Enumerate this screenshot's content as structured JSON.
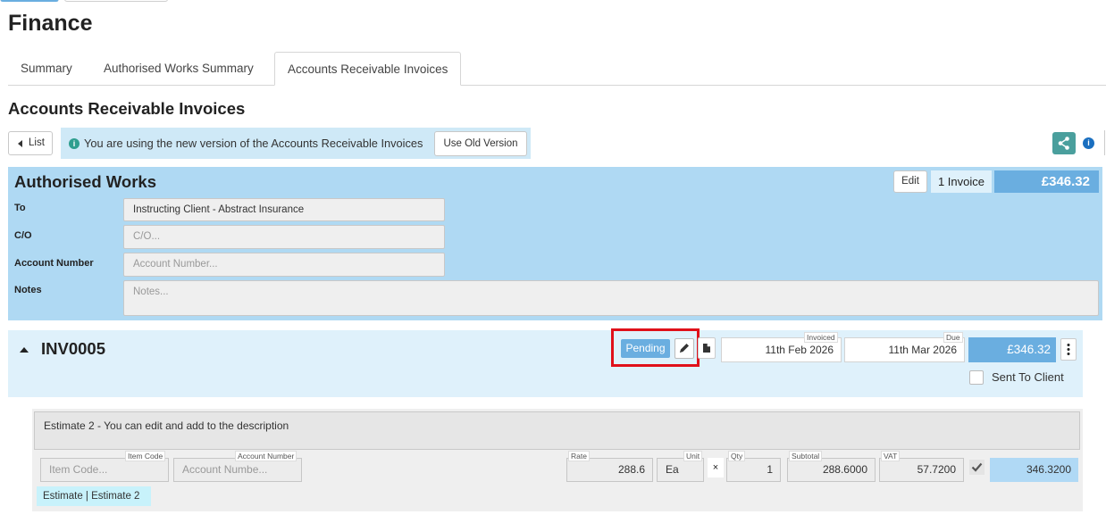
{
  "page": {
    "title": "Finance"
  },
  "tabs": [
    {
      "label": "Summary"
    },
    {
      "label": "Authorised Works Summary"
    },
    {
      "label": "Accounts Receivable Invoices"
    }
  ],
  "section": {
    "title": "Accounts Receivable Invoices",
    "list_button": "List",
    "notice": "You are using the new version of the Accounts Receivable Invoices",
    "old_version_button": "Use Old Version"
  },
  "authorised_works": {
    "title": "Authorised Works",
    "edit_button": "Edit",
    "invoice_count": "1 Invoice",
    "total": "£346.32",
    "to_label": "To",
    "to_value": "Instructing Client - Abstract Insurance",
    "co_label": "C/O",
    "co_placeholder": "C/O...",
    "account_label": "Account Number",
    "account_placeholder": "Account Number...",
    "notes_label": "Notes",
    "notes_placeholder": "Notes..."
  },
  "invoice": {
    "number": "INV0005",
    "status": "Pending",
    "invoiced_label": "Invoiced",
    "invoiced_date": "11th Feb 2026",
    "due_label": "Due",
    "due_date": "11th Mar 2026",
    "amount": "£346.32",
    "sent_label": "Sent To Client",
    "sent": false
  },
  "line_item": {
    "description": "Estimate 2 - You can edit and add to the description",
    "item_code_label": "Item Code",
    "item_code_placeholder": "Item Code...",
    "account_label": "Account Number",
    "account_placeholder": "Account Numbe...",
    "rate_label": "Rate",
    "rate": "288.6",
    "unit_label": "Unit",
    "unit": "Ea",
    "times": "×",
    "qty_label": "Qty",
    "qty": "1",
    "subtotal_label": "Subtotal",
    "subtotal": "288.6000",
    "vat_label": "VAT",
    "vat": "57.7200",
    "vat_checked": true,
    "total": "346.3200",
    "tag": "Estimate | Estimate 2"
  },
  "icons": {
    "info": "info-icon",
    "share": "share-icon",
    "edit": "pencil-icon",
    "document": "document-icon",
    "menu": "kebab-menu-icon"
  },
  "colors": {
    "panel": "#afd9f3",
    "invoice_panel": "#dff1fb",
    "accent": "#6aaee0",
    "highlight": "#e0101a",
    "teal": "#4a9f9d"
  }
}
